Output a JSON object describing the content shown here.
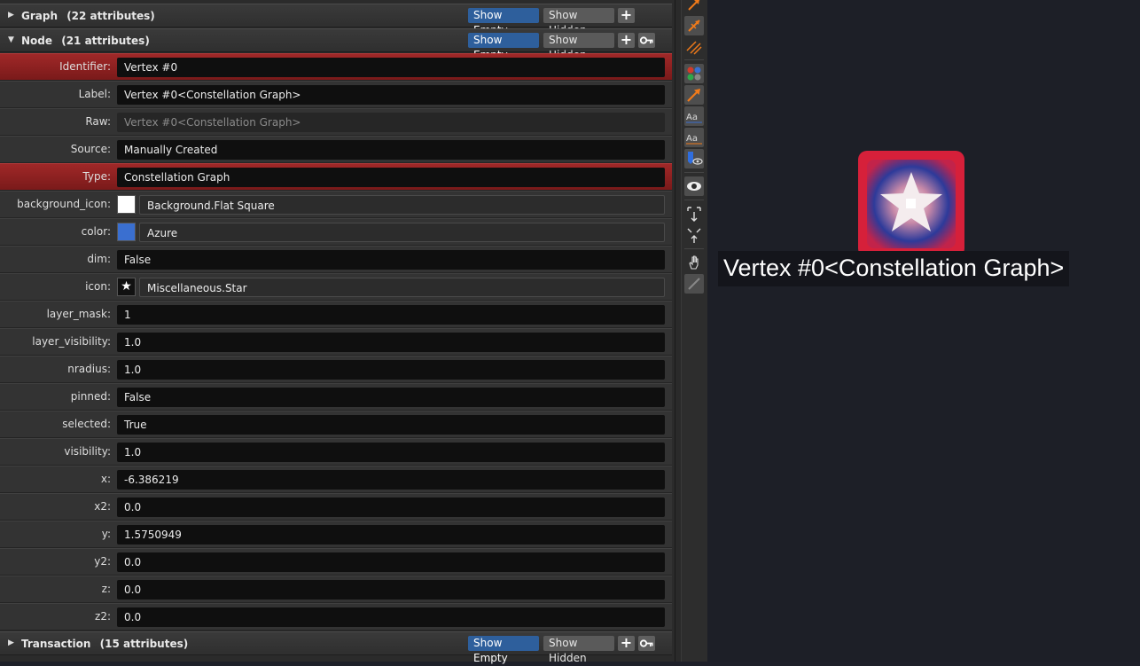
{
  "sections": {
    "graph": {
      "title": "Graph",
      "count": "(22 attributes)",
      "show_empty": "Show Empty",
      "show_hidden": "Show Hidden",
      "add": "+"
    },
    "node": {
      "title": "Node",
      "count": "(21 attributes)",
      "show_empty": "Show Empty",
      "show_hidden": "Show Hidden",
      "add": "+"
    },
    "transaction": {
      "title": "Transaction",
      "count": "(15 attributes)",
      "show_empty": "Show Empty",
      "show_hidden": "Show Hidden",
      "add": "+"
    }
  },
  "node_attributes": [
    {
      "label": "Identifier:",
      "value": "Vertex #0",
      "key": true
    },
    {
      "label": "Label:",
      "value": "Vertex #0<Constellation Graph>"
    },
    {
      "label": "Raw:",
      "value": "Vertex #0<Constellation Graph>",
      "dim": true
    },
    {
      "label": "Source:",
      "value": "Manually Created"
    },
    {
      "label": "Type:",
      "value": "Constellation Graph",
      "key": true
    },
    {
      "label": "background_icon:",
      "value": "Background.Flat Square",
      "swatch_color": "#ffffff"
    },
    {
      "label": "color:",
      "value": "Azure",
      "swatch_color": "#3a6fd0"
    },
    {
      "label": "dim:",
      "value": "False"
    },
    {
      "label": "icon:",
      "value": "Miscellaneous.Star",
      "icon": "star-icon"
    },
    {
      "label": "layer_mask:",
      "value": "1"
    },
    {
      "label": "layer_visibility:",
      "value": "1.0"
    },
    {
      "label": "nradius:",
      "value": "1.0"
    },
    {
      "label": "pinned:",
      "value": "False"
    },
    {
      "label": "selected:",
      "value": "True"
    },
    {
      "label": "visibility:",
      "value": "1.0"
    },
    {
      "label": "x:",
      "value": "-6.386219"
    },
    {
      "label": "x2:",
      "value": "0.0"
    },
    {
      "label": "y:",
      "value": "1.5750949"
    },
    {
      "label": "y2:",
      "value": "0.0"
    },
    {
      "label": "z:",
      "value": "0.0"
    },
    {
      "label": "z2:",
      "value": "0.0"
    }
  ],
  "toolbar": {
    "tools": [
      "draw-edge-icon",
      "draw-directed-edge-icon",
      "draw-undirected-edge-icon",
      "color-nodes-icon",
      "transaction-direction-icon",
      "node-labels-icon",
      "transaction-labels-icon",
      "blaze-visibility-icon",
      "toggle-visibility-icon",
      "expand-icon",
      "contract-icon",
      "pan-hand-icon",
      "link-tool-icon"
    ]
  },
  "graph_view": {
    "vertex_label": "Vertex #0<Constellation Graph>",
    "vertex_color": "#3a6fd0",
    "selection_color": "#d6203a"
  },
  "colors": {
    "accent_button": "#2e5f9c",
    "key_row": "#a02828",
    "panel": "#2b2b2b",
    "canvas": "#1d1f27"
  }
}
